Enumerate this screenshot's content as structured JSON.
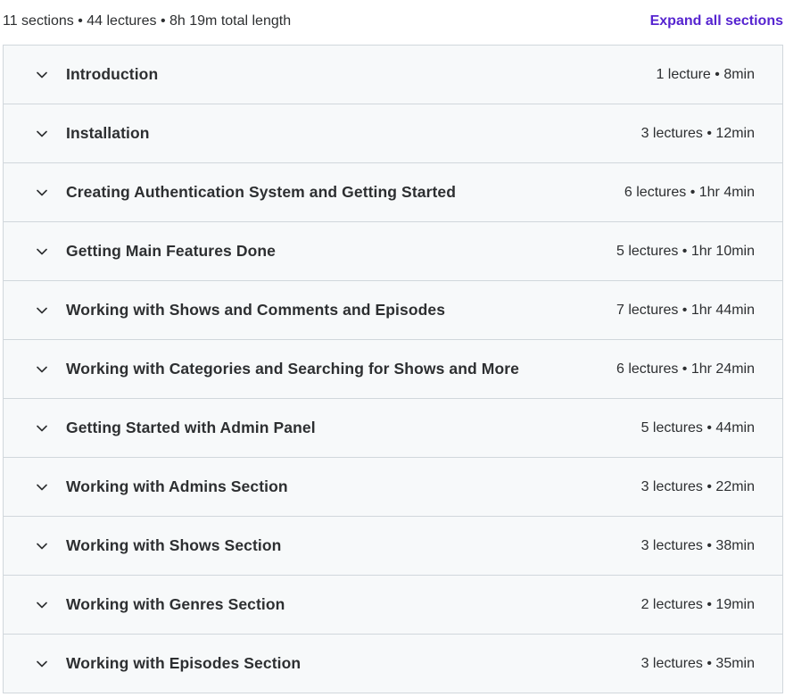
{
  "header": {
    "summary": "11 sections • 44 lectures • 8h 19m total length",
    "expand_label": "Expand all sections"
  },
  "colors": {
    "accent": "#5624d0",
    "row_background": "#f7f9fa",
    "border": "#d1d7dc",
    "text": "#2d2f31"
  },
  "sections": [
    {
      "title": "Introduction",
      "meta": "1 lecture • 8min",
      "icon": "chevron-down-icon"
    },
    {
      "title": "Installation",
      "meta": "3 lectures • 12min",
      "icon": "chevron-down-icon"
    },
    {
      "title": "Creating Authentication System and Getting Started",
      "meta": "6 lectures • 1hr 4min",
      "icon": "chevron-down-icon"
    },
    {
      "title": "Getting Main Features Done",
      "meta": "5 lectures • 1hr 10min",
      "icon": "chevron-down-icon"
    },
    {
      "title": "Working with Shows and Comments and Episodes",
      "meta": "7 lectures • 1hr 44min",
      "icon": "chevron-down-icon"
    },
    {
      "title": "Working with Categories and Searching for Shows and More",
      "meta": "6 lectures • 1hr 24min",
      "icon": "chevron-down-icon"
    },
    {
      "title": "Getting Started with Admin Panel",
      "meta": "5 lectures • 44min",
      "icon": "chevron-down-icon"
    },
    {
      "title": "Working with Admins Section",
      "meta": "3 lectures • 22min",
      "icon": "chevron-down-icon"
    },
    {
      "title": "Working with Shows Section",
      "meta": "3 lectures • 38min",
      "icon": "chevron-down-icon"
    },
    {
      "title": "Working with Genres Section",
      "meta": "2 lectures • 19min",
      "icon": "chevron-down-icon"
    },
    {
      "title": "Working with Episodes Section",
      "meta": "3 lectures • 35min",
      "icon": "chevron-down-icon"
    }
  ]
}
